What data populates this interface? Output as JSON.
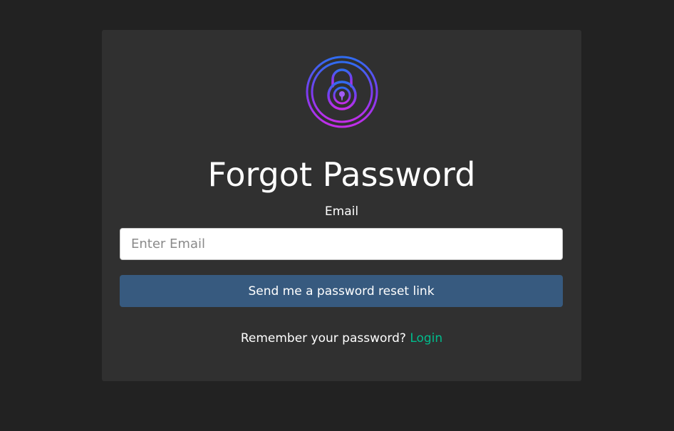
{
  "form": {
    "logo_icon": "padlock-icon",
    "title": "Forgot Password",
    "email_label": "Email",
    "email_placeholder": "Enter Email",
    "email_value": "",
    "submit_label": "Send me a password reset link",
    "remember_text": "Remember your password?",
    "login_link_label": "Login"
  },
  "colors": {
    "page_background": "#222222",
    "card_background": "#303030",
    "primary_button": "#375a7f",
    "link": "#00bc8c",
    "logo_gradient_start": "#2f6cf0",
    "logo_gradient_end": "#c42ee8"
  }
}
